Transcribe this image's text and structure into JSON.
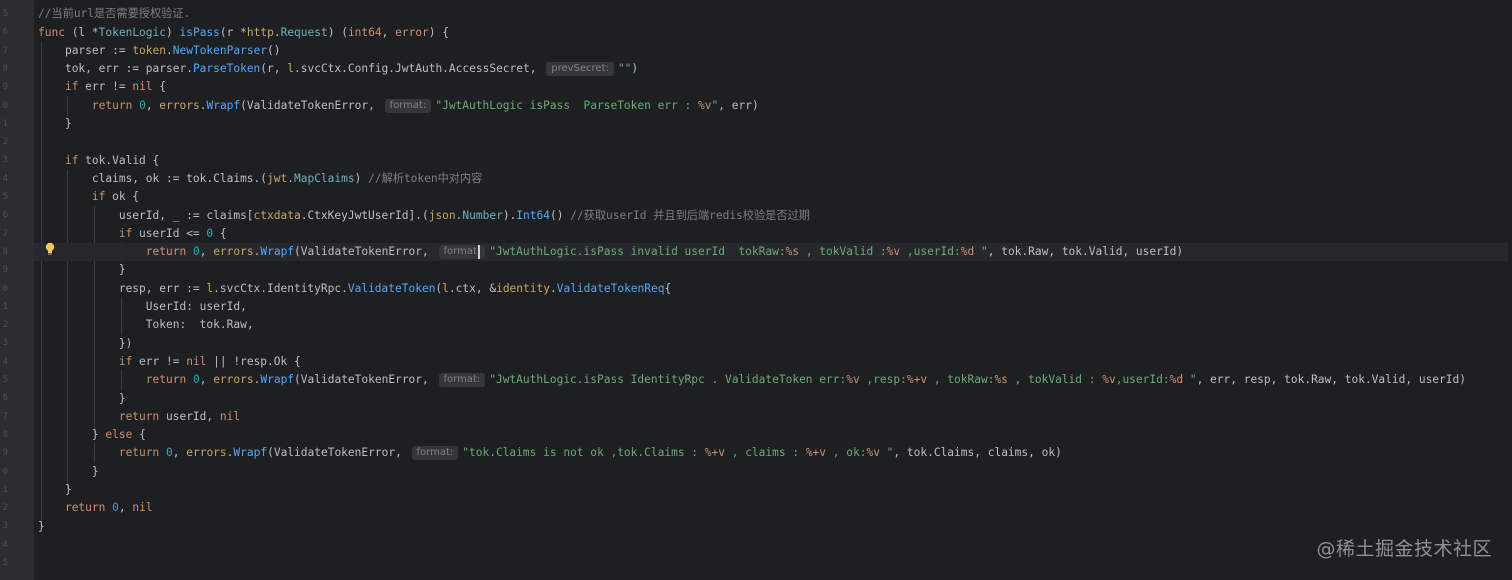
{
  "gutter_numbers": [
    "5",
    "6",
    "7",
    "8",
    "9",
    "0",
    "1",
    "2",
    "3",
    "4",
    "5",
    "6",
    "7",
    "8",
    "9",
    "0",
    "1",
    "2",
    "3",
    "4",
    "5",
    "6",
    "7",
    "8",
    "9",
    "0",
    "1",
    "2",
    "3",
    "4",
    "5"
  ],
  "code": {
    "comment_top": "//当前url是否需要授权验证.",
    "func_kw": "func",
    "recv_open": " (l *",
    "recv_type": "TokenLogic",
    "recv_close": ") ",
    "func_name": "isPass",
    "params_open": "(r *",
    "param_pkg": "http",
    "param_type": "Request",
    "params_close": ") (",
    "ret_t1": "int64",
    "ret_sep": ", ",
    "ret_t2": "error",
    "ret_close": ") {",
    "l2_a": "parser := ",
    "l2_pkg": "token",
    "l2_fn": "NewTokenParser",
    "l2_b": "()",
    "l3_a": "tok, err := parser.",
    "l3_fn": "ParseToken",
    "l3_b": "(r, ",
    "l3_l": "l",
    "l3_c": ".svcCtx.Config.JwtAuth.AccessSecret, ",
    "l3_hint": "prevSecret:",
    "l3_str": "\"\"",
    "l3_d": ")",
    "if_kw": "if",
    "l4_a": " err != ",
    "nil_kw": "nil",
    "l4_b": " {",
    "return_kw": "return",
    "zero": "0",
    "comma": ", ",
    "errors_pkg": "errors",
    "wrapf": "Wrapf",
    "vte": "(ValidateTokenError, ",
    "hint_format": "format:",
    "l5_str1": "\"JwtAuthLogic isPass  ParseToken err : ",
    "fmt_v": "%v",
    "str_end": "\"",
    "l5_tail": ", err)",
    "close_brace": "}",
    "l8_a": " tok.Valid {",
    "l9_a": "claims, ok := tok.Claims.(",
    "jwt_pkg": "jwt",
    "mapclaims": "MapClaims",
    "l9_b": ") ",
    "l9_cmt": "//解析token中对内容",
    "l10_a": " ok {",
    "l11_a": "userId, _ := claims[",
    "ctx_pkg": "ctxdata",
    "l11_b": ".CtxKeyJwtUserId].(",
    "json_pkg": "json",
    "number_t": "Number",
    "l11_c": ").",
    "int64_fn": "Int64",
    "l11_d": "() ",
    "l11_cmt": "//获取userId 并且到后端redis校验是否过期",
    "l12_a": " userId <= ",
    "l12_b": " {",
    "l13_s1": "\"JwtAuthLogic.isPass invalid userId  tokRaw:",
    "fmt_s": "%s",
    "l13_s2": " , tokValid :",
    "l13_s3": " ,userId:",
    "fmt_d": "%d",
    "l13_s4": " \"",
    "l13_tail": ", tok.Raw, tok.Valid, userId)",
    "l15_a": "resp, err := ",
    "l15_b": ".svcCtx.IdentityRpc.",
    "l15_fn": "ValidateToken",
    "l15_c": "(",
    "l15_d": ".ctx, &",
    "identity_pkg": "identity",
    "l15_e": ".",
    "l15_type": "ValidateTokenReq",
    "l15_f": "{",
    "l16_a": "UserId: userId,",
    "l17_a": "Token:  tok.Raw,",
    "l18_a": "})",
    "l19_a": " err != ",
    "l19_b": " || !resp.Ok {",
    "l20_s1": "\"JwtAuthLogic.isPass IdentityRpc . ValidateToken err:",
    "l20_s2": " ,resp:",
    "fmt_pv": "%+v",
    "l20_s3": " , tokRaw:",
    "l20_s4": " , tokValid : ",
    "l20_s5": ",userId:",
    "l20_tail": ", err, resp, tok.Raw, tok.Valid, userId)",
    "l22_a": " userId, ",
    "else_a": "} ",
    "else_kw": "else",
    "else_b": " {",
    "l24_s1": "\"tok.Claims is not ok ,tok.Claims : ",
    "l24_s2": " , claims : ",
    "l24_s3": " , ok:",
    "l24_tail": ", tok.Claims, claims, ok)",
    "l27_a": " ",
    "l27_b": ", "
  },
  "watermark": "@稀土掘金技术社区",
  "icons": {
    "intention": "lightbulb-icon"
  },
  "colors": {
    "editor_bg": "#1e1f22",
    "keyword": "#cf8e6d",
    "function": "#56a8f5",
    "string": "#6aab73",
    "number": "#2aacb8",
    "comment": "#7a7e85",
    "package": "#c7a65d"
  }
}
